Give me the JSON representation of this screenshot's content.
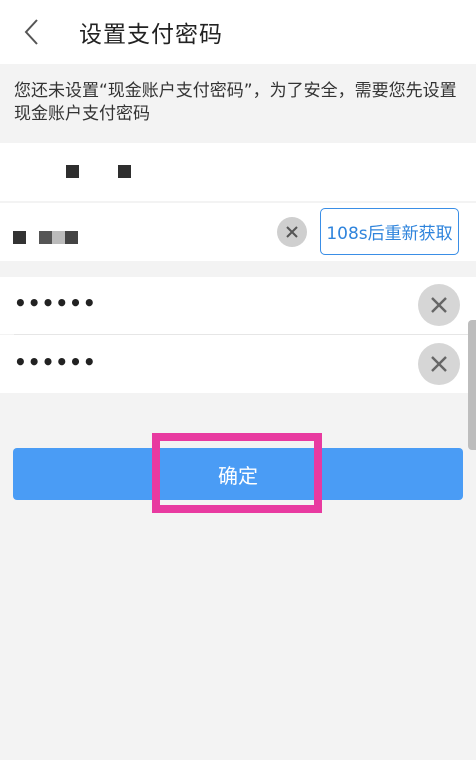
{
  "header": {
    "title": "设置支付密码",
    "back_icon": "chevron-left-icon"
  },
  "notice": {
    "text": "您还未设置“现金账户支付密码”，为了安全，需要您先设置现金账户支付密码"
  },
  "phone_row": {
    "value_masked": true
  },
  "code_row": {
    "value_masked": true,
    "clear_icon": "close-icon",
    "resend_label": "108s后重新获取"
  },
  "password_rows": [
    {
      "value": "••••••",
      "clear_icon": "close-icon"
    },
    {
      "value": "••••••",
      "clear_icon": "close-icon"
    }
  ],
  "confirm": {
    "label": "确定"
  },
  "colors": {
    "accent": "#4a9cf5",
    "highlight": "#e83aa0",
    "resend_text": "#2f84dc"
  }
}
